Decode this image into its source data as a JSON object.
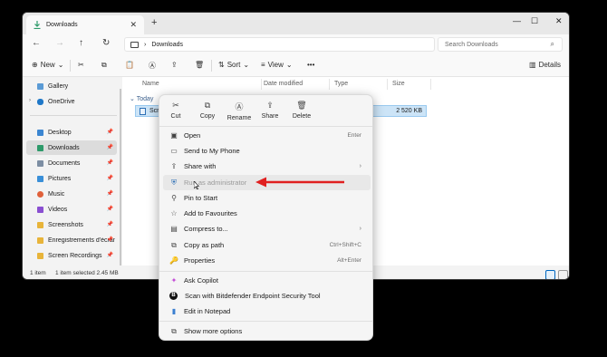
{
  "titlebar": {
    "tab_title": "Downloads",
    "tab_close": "✕",
    "new_tab": "+",
    "minimize": "—",
    "maximize": "☐",
    "close": "✕"
  },
  "nav": {
    "back": "←",
    "forward": "→",
    "up": "↑",
    "refresh": "↻",
    "chevron": "›",
    "location": "Downloads",
    "search_placeholder": "Search Downloads",
    "search_icon": "⌕"
  },
  "toolbar": {
    "new_label": "New",
    "new_icon": "⊕",
    "chev": "⌄",
    "cut": "✂",
    "copy": "⧉",
    "paste": "📋",
    "rename": "Ⓐ",
    "share": "⇪",
    "delete": "🗑",
    "sort_label": "Sort",
    "sort_icon": "⇅",
    "view_label": "View",
    "view_icon": "≡",
    "more": "•••",
    "details_label": "Details",
    "details_icon": "▥"
  },
  "sidebar": {
    "pin": "📌",
    "expand": "›",
    "items": [
      {
        "label": "Gallery",
        "color": "#5b9bd5"
      },
      {
        "label": "OneDrive",
        "color": "#1f78c8"
      },
      {
        "label": "Desktop",
        "color": "#3b86d1"
      },
      {
        "label": "Downloads",
        "color": "#2d9a6a"
      },
      {
        "label": "Documents",
        "color": "#7d8ea3"
      },
      {
        "label": "Pictures",
        "color": "#3a8fd8"
      },
      {
        "label": "Music",
        "color": "#e0603a"
      },
      {
        "label": "Videos",
        "color": "#8a4fd1"
      },
      {
        "label": "Screenshots",
        "color": "#e8b43a"
      },
      {
        "label": "Enregistrements d'écran",
        "color": "#e8b43a"
      },
      {
        "label": "Screen Recordings",
        "color": "#e8b43a"
      }
    ]
  },
  "content": {
    "columns": [
      "Name",
      "Date modified",
      "Type",
      "Size"
    ],
    "group": "Today",
    "file": {
      "name": "Scre",
      "size": "2 520 KB"
    }
  },
  "status": {
    "count": "1 item",
    "selection": "1 item selected  2.45 MB"
  },
  "context_menu": {
    "quick_actions": [
      {
        "label": "Cut",
        "icon": "✂"
      },
      {
        "label": "Copy",
        "icon": "⧉"
      },
      {
        "label": "Rename",
        "icon": "Ⓐ"
      },
      {
        "label": "Share",
        "icon": "⇪"
      },
      {
        "label": "Delete",
        "icon": "🗑"
      }
    ],
    "items": [
      {
        "label": "Open",
        "shortcut": "Enter",
        "icon": "▣"
      },
      {
        "label": "Send to My Phone",
        "shortcut": "",
        "icon": "▭"
      },
      {
        "label": "Share with",
        "shortcut": "›",
        "icon": "⇪"
      },
      {
        "label": "Run as administrator",
        "shortcut": "",
        "icon": "⛨"
      },
      {
        "label": "Pin to Start",
        "shortcut": "",
        "icon": "⚲"
      },
      {
        "label": "Add to Favourites",
        "shortcut": "",
        "icon": "☆"
      },
      {
        "label": "Compress to...",
        "shortcut": "›",
        "icon": "▤"
      },
      {
        "label": "Copy as path",
        "shortcut": "Ctrl+Shift+C",
        "icon": "⧉"
      },
      {
        "label": "Properties",
        "shortcut": "Alt+Enter",
        "icon": "🔑"
      },
      {
        "label": "Ask Copilot",
        "shortcut": "",
        "icon": "✦"
      },
      {
        "label": "Scan with Bitdefender Endpoint Security Tool",
        "shortcut": "",
        "icon": "B"
      },
      {
        "label": "Edit in Notepad",
        "shortcut": "",
        "icon": "▮"
      },
      {
        "label": "Show more options",
        "shortcut": "",
        "icon": "⧉"
      }
    ]
  },
  "colors": {
    "accent": "#0067c0",
    "annotation_arrow": "#e02020",
    "selection": "#cce4f7"
  }
}
